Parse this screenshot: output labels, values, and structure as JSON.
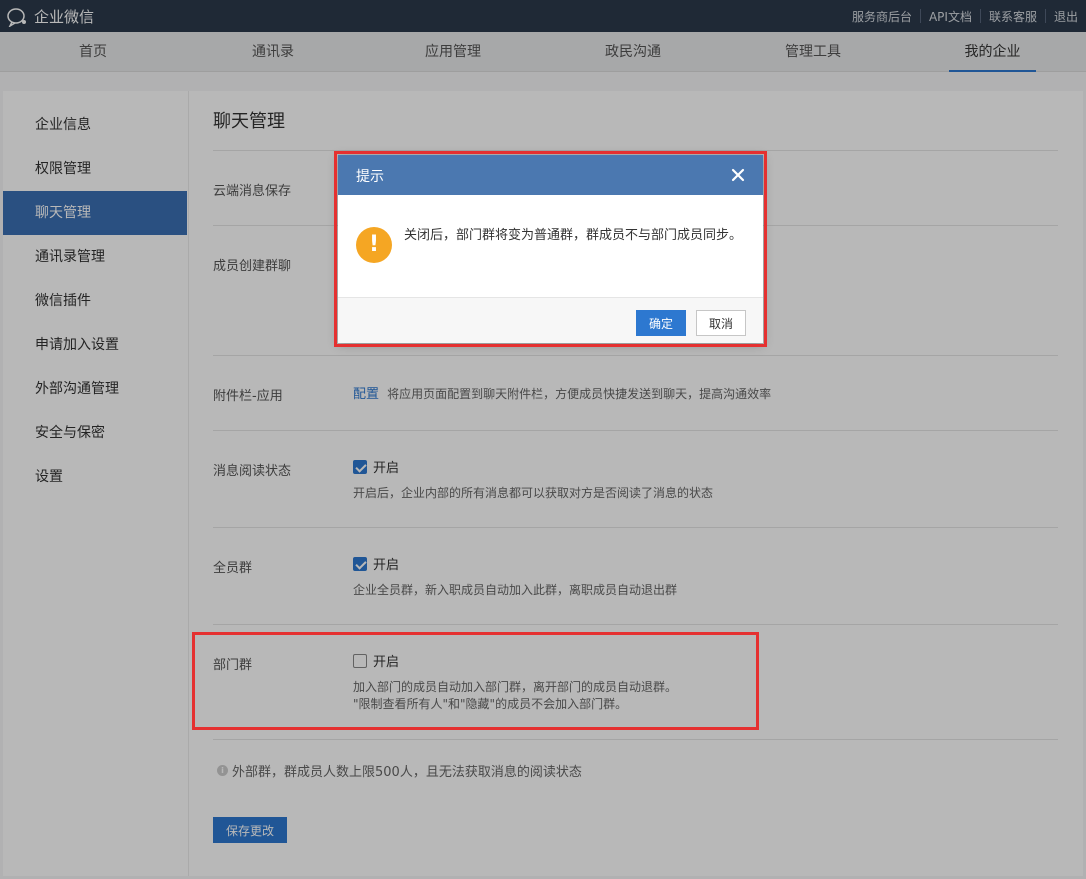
{
  "app": {
    "name": "企业微信"
  },
  "top_links": [
    "服务商后台",
    "API文档",
    "联系客服",
    "退出"
  ],
  "nav": {
    "items": [
      "首页",
      "通讯录",
      "应用管理",
      "政民沟通",
      "管理工具",
      "我的企业"
    ],
    "active": "我的企业"
  },
  "sidebar": {
    "items": [
      "企业信息",
      "权限管理",
      "聊天管理",
      "通讯录管理",
      "微信插件",
      "申请加入设置",
      "外部沟通管理",
      "安全与保密",
      "设置"
    ],
    "active": "聊天管理"
  },
  "content": {
    "title": "聊天管理",
    "rows": {
      "cloud_storage": {
        "label": "云端消息保存"
      },
      "member_create_group": {
        "label": "成员创建群聊"
      },
      "attachment_bar": {
        "label": "附件栏-应用",
        "link": "配置",
        "desc": "将应用页面配置到聊天附件栏，方便成员快捷发送到聊天，提高沟通效率"
      },
      "read_status": {
        "label": "消息阅读状态",
        "option": "开启",
        "checked": true,
        "hint": "开启后，企业内部的所有消息都可以获取对方是否阅读了消息的状态"
      },
      "all_staff_group": {
        "label": "全员群",
        "option": "开启",
        "checked": true,
        "hint": "企业全员群，新入职成员自动加入此群，离职成员自动退出群"
      },
      "dept_group": {
        "label": "部门群",
        "option": "开启",
        "checked": false,
        "hint_line1": "加入部门的成员自动加入部门群，离开部门的成员自动退群。",
        "hint_line2": "\"限制查看所有人\"和\"隐藏\"的成员不会加入部门群。"
      }
    },
    "info": "外部群，群成员人数上限500人，且无法获取消息的阅读状态",
    "save_label": "保存更改"
  },
  "modal": {
    "title": "提示",
    "message": "关闭后，部门群将变为普通群，群成员不与部门成员同步。",
    "ok_label": "确定",
    "cancel_label": "取消"
  },
  "colors": {
    "topbar": "#2b3a4c",
    "accent": "#2d78d0",
    "sidebar_active": "#3b6fb3",
    "modal_header": "#4b78b0",
    "warning": "#f5a623",
    "highlight": "#e53030"
  }
}
